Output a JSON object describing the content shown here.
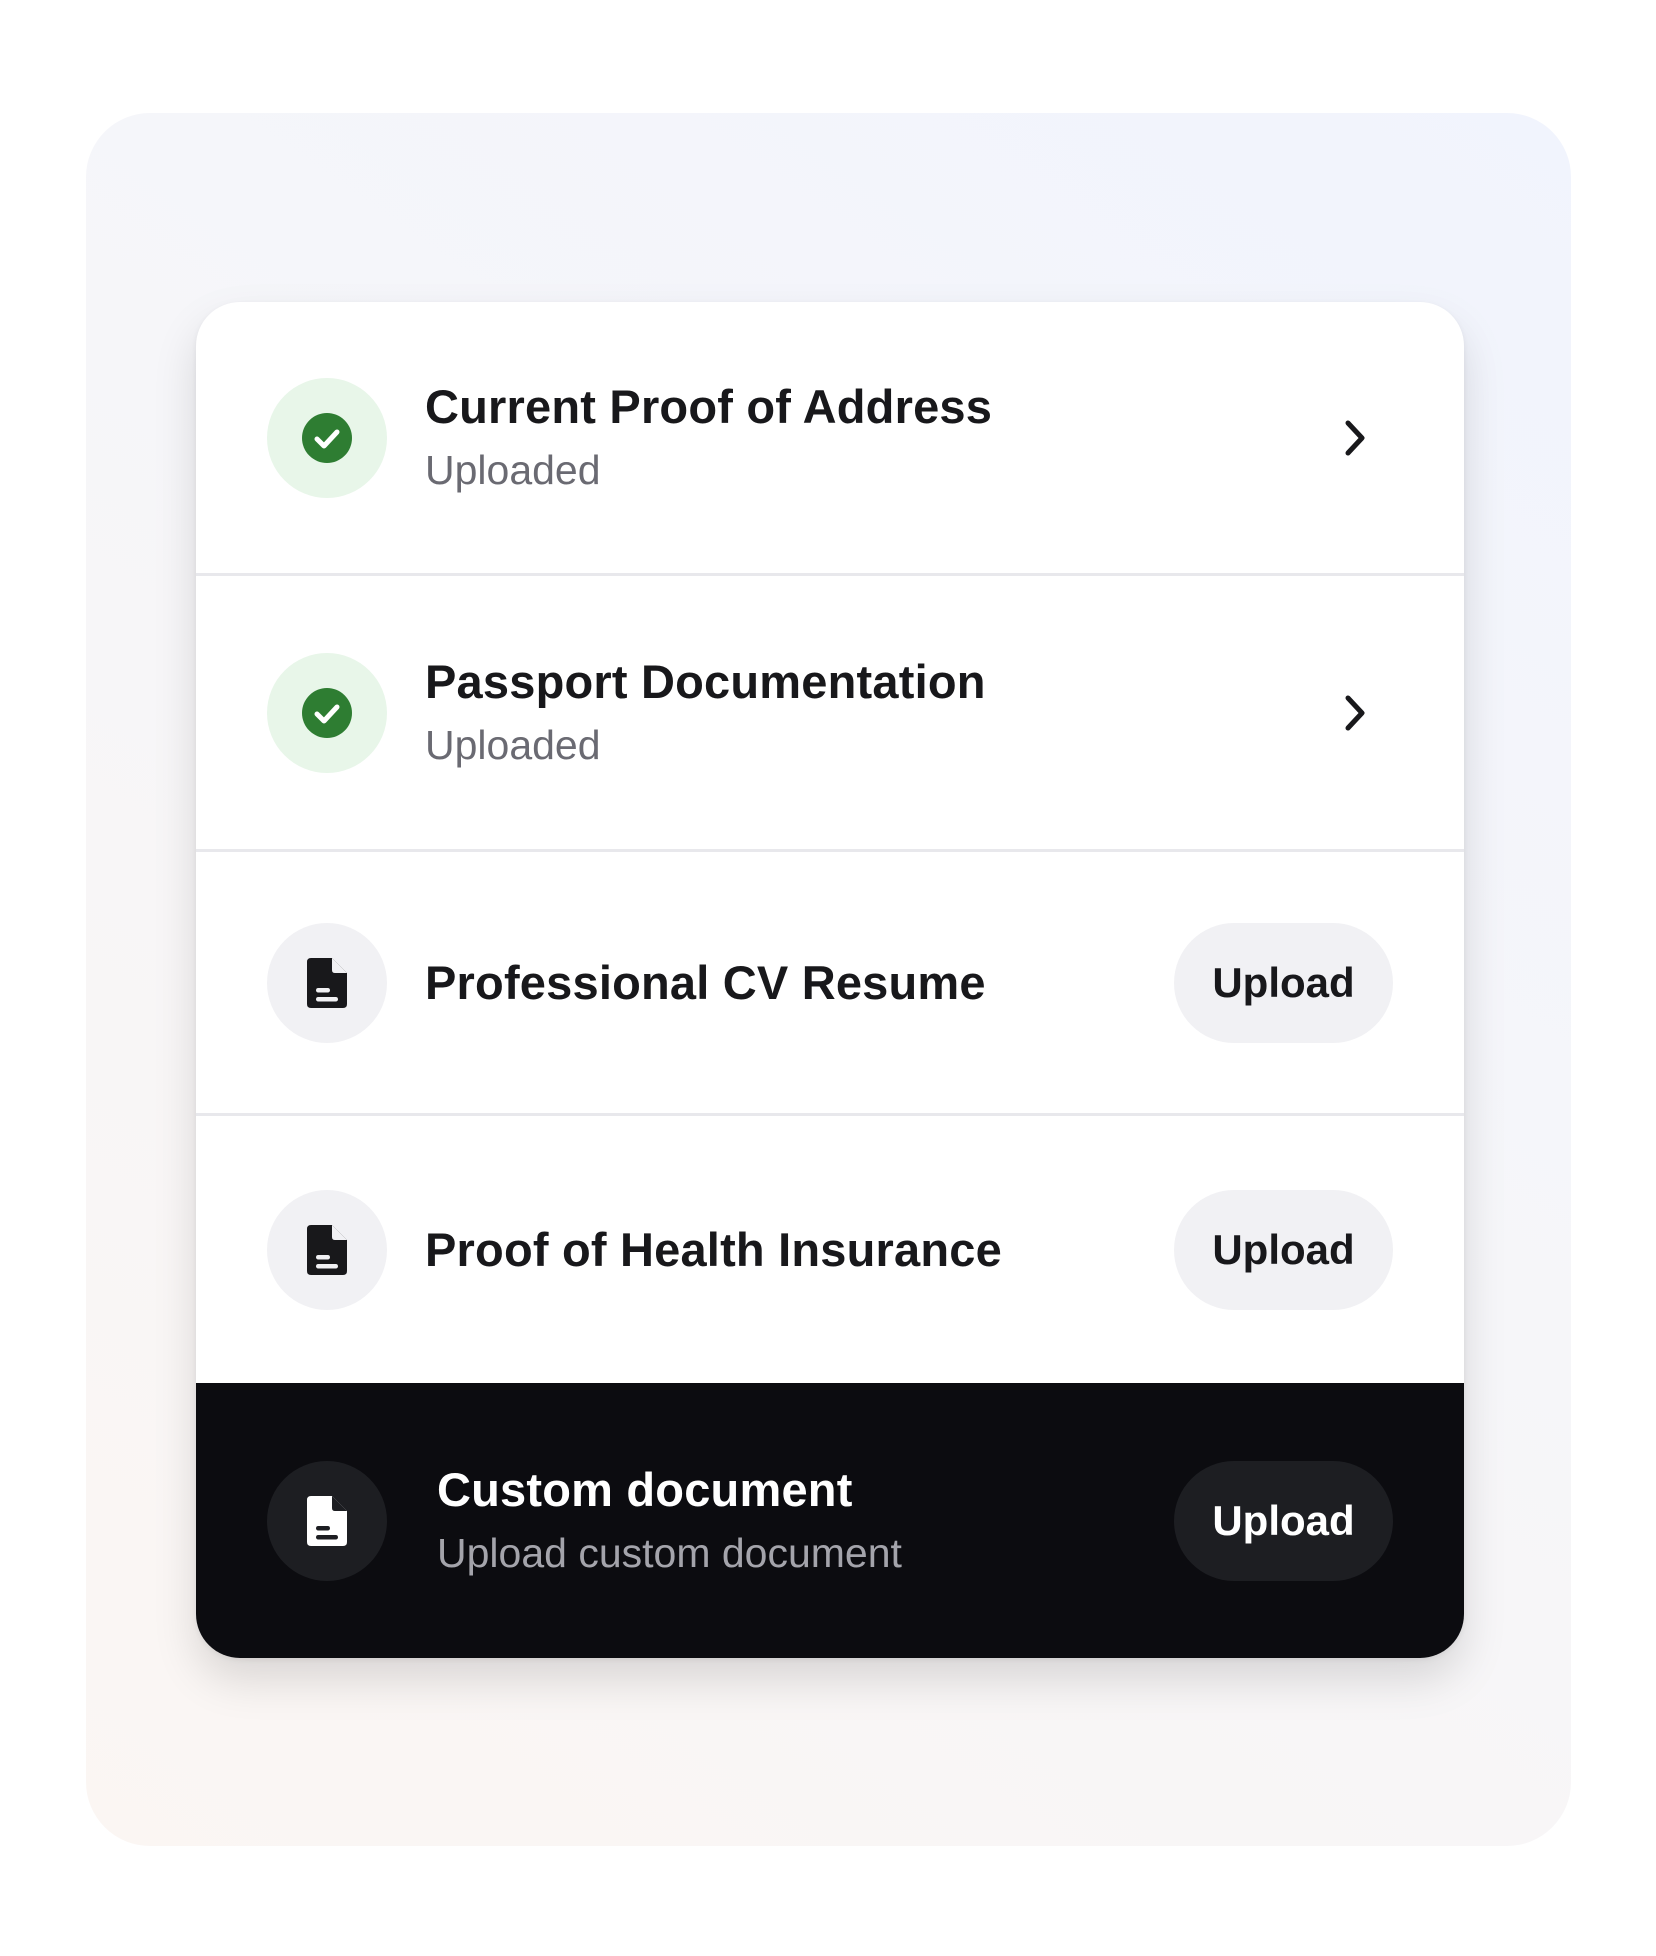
{
  "colors": {
    "success_green": "#2e7d32",
    "success_bg": "#e8f6e9",
    "dark_row_bg": "#0c0c10",
    "button_bg": "#f1f1f4"
  },
  "documents": [
    {
      "title": "Current Proof of Address",
      "subtitle": "Uploaded",
      "status_icon": "check-circle-icon",
      "action_icon": "chevron-right-icon"
    },
    {
      "title": "Passport Documentation",
      "subtitle": "Uploaded",
      "status_icon": "check-circle-icon",
      "action_icon": "chevron-right-icon"
    },
    {
      "title": "Professional CV Resume",
      "status_icon": "document-icon",
      "action_label": "Upload"
    },
    {
      "title": "Proof of Health Insurance",
      "status_icon": "document-icon",
      "action_label": "Upload"
    }
  ],
  "custom": {
    "title": "Custom document",
    "subtitle": "Upload custom document",
    "status_icon": "document-icon",
    "action_label": "Upload"
  }
}
